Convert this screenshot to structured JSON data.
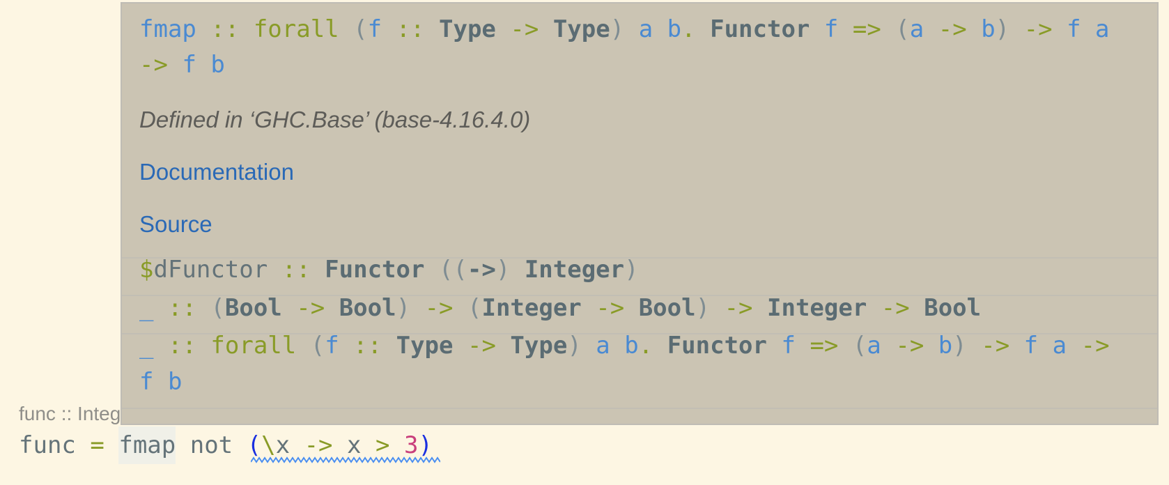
{
  "popup": {
    "signature": {
      "line1": [
        {
          "t": "fmap",
          "c": "var"
        },
        {
          "t": " "
        },
        {
          "t": "::",
          "c": "kw"
        },
        {
          "t": " "
        },
        {
          "t": "forall",
          "c": "kw"
        },
        {
          "t": " "
        },
        {
          "t": "(",
          "c": "par"
        },
        {
          "t": "f",
          "c": "var"
        },
        {
          "t": " "
        },
        {
          "t": "::",
          "c": "kw"
        },
        {
          "t": " "
        },
        {
          "t": "Type",
          "c": "con"
        },
        {
          "t": " "
        },
        {
          "t": "->",
          "c": "kw"
        },
        {
          "t": " "
        },
        {
          "t": "Type",
          "c": "con"
        },
        {
          "t": ")",
          "c": "par"
        },
        {
          "t": " "
        },
        {
          "t": "a",
          "c": "var"
        },
        {
          "t": " "
        },
        {
          "t": "b",
          "c": "var"
        },
        {
          "t": ".",
          "c": "kw"
        },
        {
          "t": " "
        },
        {
          "t": "Functor",
          "c": "con"
        },
        {
          "t": " "
        },
        {
          "t": "f",
          "c": "var"
        },
        {
          "t": " "
        },
        {
          "t": "=>",
          "c": "kw"
        },
        {
          "t": " "
        },
        {
          "t": "(",
          "c": "par"
        },
        {
          "t": "a",
          "c": "var"
        },
        {
          "t": " "
        },
        {
          "t": "->",
          "c": "kw"
        },
        {
          "t": " "
        },
        {
          "t": "b",
          "c": "var"
        },
        {
          "t": ")",
          "c": "par"
        },
        {
          "t": " "
        },
        {
          "t": "->",
          "c": "kw"
        },
        {
          "t": " "
        },
        {
          "t": "f",
          "c": "var"
        },
        {
          "t": " "
        },
        {
          "t": "a",
          "c": "var"
        }
      ],
      "line2": [
        {
          "t": "->",
          "c": "kw"
        },
        {
          "t": " "
        },
        {
          "t": "f",
          "c": "var"
        },
        {
          "t": " "
        },
        {
          "t": "b",
          "c": "var"
        }
      ]
    },
    "defined_in": "Defined in ‘GHC.Base’ (base-4.16.4.0)",
    "documentation_link": "Documentation",
    "source_link": "Source",
    "instances": [
      [
        {
          "t": "$",
          "c": "kw"
        },
        {
          "t": "dFunctor",
          "c": "plain"
        },
        {
          "t": " "
        },
        {
          "t": "::",
          "c": "kw"
        },
        {
          "t": " "
        },
        {
          "t": "Functor",
          "c": "con"
        },
        {
          "t": " "
        },
        {
          "t": "((",
          "c": "par"
        },
        {
          "t": "->",
          "c": "con"
        },
        {
          "t": ")",
          "c": "par"
        },
        {
          "t": " "
        },
        {
          "t": "Integer",
          "c": "con"
        },
        {
          "t": ")",
          "c": "par"
        }
      ],
      [
        {
          "t": "_",
          "c": "var"
        },
        {
          "t": " "
        },
        {
          "t": "::",
          "c": "kw"
        },
        {
          "t": " "
        },
        {
          "t": "(",
          "c": "par"
        },
        {
          "t": "Bool",
          "c": "con"
        },
        {
          "t": " "
        },
        {
          "t": "->",
          "c": "kw"
        },
        {
          "t": " "
        },
        {
          "t": "Bool",
          "c": "con"
        },
        {
          "t": ")",
          "c": "par"
        },
        {
          "t": " "
        },
        {
          "t": "->",
          "c": "kw"
        },
        {
          "t": " "
        },
        {
          "t": "(",
          "c": "par"
        },
        {
          "t": "Integer",
          "c": "con"
        },
        {
          "t": " "
        },
        {
          "t": "->",
          "c": "kw"
        },
        {
          "t": " "
        },
        {
          "t": "Bool",
          "c": "con"
        },
        {
          "t": ")",
          "c": "par"
        },
        {
          "t": " "
        },
        {
          "t": "->",
          "c": "kw"
        },
        {
          "t": " "
        },
        {
          "t": "Integer",
          "c": "con"
        },
        {
          "t": " "
        },
        {
          "t": "->",
          "c": "kw"
        },
        {
          "t": " "
        },
        {
          "t": "Bool",
          "c": "con"
        }
      ],
      [
        {
          "t": "_",
          "c": "var"
        },
        {
          "t": " "
        },
        {
          "t": "::",
          "c": "kw"
        },
        {
          "t": " "
        },
        {
          "t": "forall",
          "c": "kw"
        },
        {
          "t": " "
        },
        {
          "t": "(",
          "c": "par"
        },
        {
          "t": "f",
          "c": "var"
        },
        {
          "t": " "
        },
        {
          "t": "::",
          "c": "kw"
        },
        {
          "t": " "
        },
        {
          "t": "Type",
          "c": "con"
        },
        {
          "t": " "
        },
        {
          "t": "->",
          "c": "kw"
        },
        {
          "t": " "
        },
        {
          "t": "Type",
          "c": "con"
        },
        {
          "t": ")",
          "c": "par"
        },
        {
          "t": " "
        },
        {
          "t": "a",
          "c": "var"
        },
        {
          "t": " "
        },
        {
          "t": "b",
          "c": "var"
        },
        {
          "t": ".",
          "c": "kw"
        },
        {
          "t": " "
        },
        {
          "t": "Functor",
          "c": "con"
        },
        {
          "t": " "
        },
        {
          "t": "f",
          "c": "var"
        },
        {
          "t": " "
        },
        {
          "t": "=>",
          "c": "kw"
        },
        {
          "t": " "
        },
        {
          "t": "(",
          "c": "par"
        },
        {
          "t": "a",
          "c": "var"
        },
        {
          "t": " "
        },
        {
          "t": "->",
          "c": "kw"
        },
        {
          "t": " "
        },
        {
          "t": "b",
          "c": "var"
        },
        {
          "t": ")",
          "c": "par"
        },
        {
          "t": " "
        },
        {
          "t": "->",
          "c": "kw"
        },
        {
          "t": " "
        },
        {
          "t": "f",
          "c": "var"
        },
        {
          "t": " "
        },
        {
          "t": "a",
          "c": "var"
        },
        {
          "t": " "
        },
        {
          "t": "->",
          "c": "kw"
        }
      ],
      [
        {
          "t": "f",
          "c": "var"
        },
        {
          "t": " "
        },
        {
          "t": "b",
          "c": "var"
        }
      ]
    ]
  },
  "editor": {
    "inlay_hint": "func :: Integer -> Bool",
    "code_line": [
      {
        "t": "func",
        "c": "plain"
      },
      {
        "t": " "
      },
      {
        "t": "=",
        "c": "kw"
      },
      {
        "t": " "
      },
      {
        "t": "fmap",
        "c": "plain",
        "hl": true
      },
      {
        "t": " "
      },
      {
        "t": "not",
        "c": "plain"
      },
      {
        "t": " "
      },
      {
        "t": "(",
        "c": "lparen"
      },
      {
        "t": "\\",
        "c": "kw"
      },
      {
        "t": "x",
        "c": "plain"
      },
      {
        "t": " "
      },
      {
        "t": "->",
        "c": "kw"
      },
      {
        "t": " "
      },
      {
        "t": "x",
        "c": "plain"
      },
      {
        "t": " "
      },
      {
        "t": ">",
        "c": "kw"
      },
      {
        "t": " "
      },
      {
        "t": "3",
        "c": "num"
      },
      {
        "t": ")",
        "c": "lparen"
      }
    ],
    "diagnostic_squiggle_color": "#4a8ef0"
  }
}
